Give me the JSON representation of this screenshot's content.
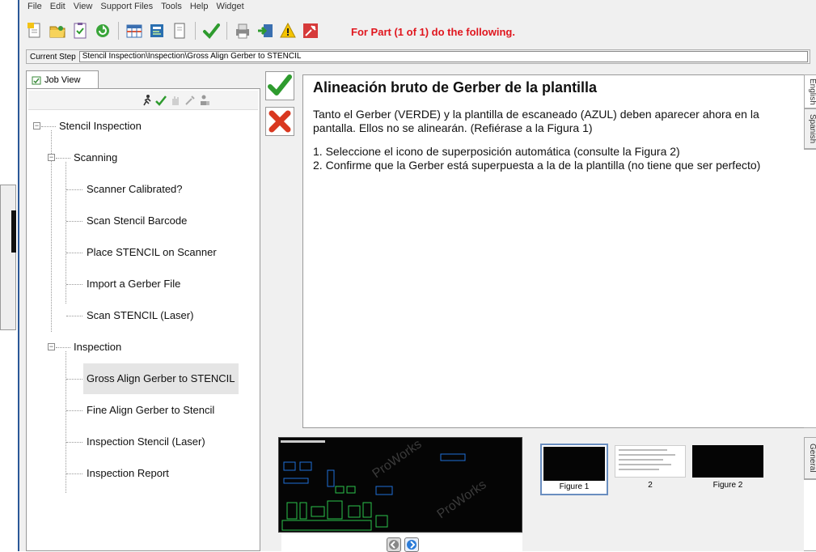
{
  "menu": [
    "File",
    "Edit",
    "View",
    "Support Files",
    "Tools",
    "Help",
    "Widget"
  ],
  "toolbar": {
    "part_message": "For Part (1 of 1) do the following.",
    "icons": [
      "new-icon",
      "open-folder-icon",
      "checklist-icon",
      "refresh-icon",
      "grid-icon",
      "report-icon",
      "document-icon",
      "checkmark-icon",
      "printer-icon",
      "import-icon",
      "warning-icon",
      "tools-icon"
    ]
  },
  "current_step": {
    "label": "Current Step",
    "value": "Stencil Inspection\\Inspection\\Gross Align Gerber to STENCIL"
  },
  "job_view": {
    "tab_label": "Job View",
    "tree": {
      "root": "Stencil Inspection",
      "scanning": "Scanning",
      "scanning_items": [
        "Scanner Calibrated?",
        "Scan Stencil Barcode",
        "Place STENCIL on Scanner",
        "Import a Gerber File",
        "Scan STENCIL (Laser)"
      ],
      "inspection": "Inspection",
      "inspection_items": [
        "Gross Align Gerber to STENCIL",
        "Fine Align Gerber to Stencil",
        "Inspection Stencil (Laser)",
        "Inspection Report"
      ]
    }
  },
  "content": {
    "title": "Alineación bruto de Gerber de la plantilla",
    "paragraph1": "Tanto el Gerber (VERDE) y la plantilla de escaneado (AZUL) deben aparecer ahora en la pantalla. Ellos no se alinearán. (Refiérase a la Figura 1)",
    "step1": "1. Seleccione el icono de superposición automática (consulte la Figura 2)",
    "step2": "2. Confirme que la Gerber está superpuesta a la de la plantilla (no tiene que ser perfecto)"
  },
  "lang_tabs": [
    "English",
    "Spanish"
  ],
  "bottom_tab": "General",
  "figures": {
    "watermark": "ProWorks",
    "labels": [
      "Figure 1",
      "2",
      "Figure 2"
    ]
  },
  "colors": {
    "accent_red": "#e0161e",
    "ok_green": "#2e9b2e",
    "cancel_red": "#d9371f",
    "frame_blue": "#2b5797"
  }
}
